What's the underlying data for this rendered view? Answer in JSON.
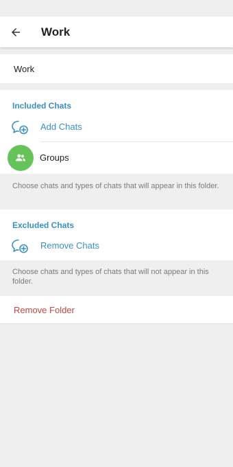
{
  "toolbar": {
    "title": "Work",
    "back_icon": "arrow-left-icon"
  },
  "folder_name": {
    "value": "Work"
  },
  "included": {
    "header": "Included Chats",
    "add_label": "Add Chats",
    "add_icon": "chat-add-icon",
    "chats": [
      {
        "label": "Groups",
        "icon": "people-icon",
        "color": "#66c35a"
      }
    ],
    "hint": "Choose chats and types of chats that will appear in this folder."
  },
  "excluded": {
    "header": "Excluded Chats",
    "remove_label": "Remove Chats",
    "remove_icon": "chat-add-icon",
    "hint": "Choose chats and types of chats that will not appear in this folder."
  },
  "remove_folder": {
    "label": "Remove Folder",
    "color": "#c8453f"
  },
  "colors": {
    "accent": "#3a8fc6",
    "background": "#efefef",
    "surface": "#ffffff"
  }
}
